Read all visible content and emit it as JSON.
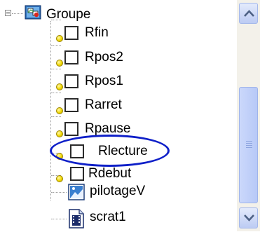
{
  "tree": {
    "root": {
      "label": "Groupe",
      "expanded": true
    },
    "items": [
      {
        "label": "Rfin",
        "type": "checkbox"
      },
      {
        "label": "Rpos2",
        "type": "checkbox"
      },
      {
        "label": "Rpos1",
        "type": "checkbox"
      },
      {
        "label": "Rarret",
        "type": "checkbox"
      },
      {
        "label": "Rpause",
        "type": "checkbox"
      },
      {
        "label": "Rlecture",
        "type": "checkbox",
        "highlighted": true
      },
      {
        "label": "Rdebut",
        "type": "checkbox"
      },
      {
        "label": "pilotageV",
        "type": "picture"
      },
      {
        "label": "scrat1",
        "type": "film"
      }
    ]
  },
  "colors": {
    "highlight": "#0e1fc8",
    "pin": "#f1d900",
    "scrollbar": "#b7c9f7"
  }
}
